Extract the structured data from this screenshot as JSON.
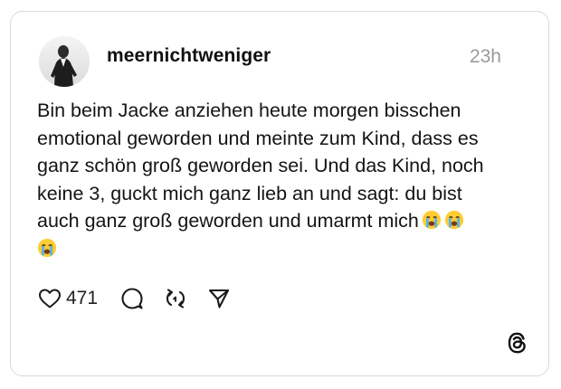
{
  "post": {
    "author": {
      "username": "meernichtweniger",
      "avatar_icon": "profile-photo"
    },
    "timestamp": "23h",
    "text_lines": [
      "Bin beim Jacke anziehen heute morgen bisschen",
      "emotional geworden und meinte zum Kind, dass es",
      "ganz schön groß geworden sei. Und das Kind, noch",
      "keine 3, guckt mich ganz lieb an und sagt: du bist",
      "auch ganz groß geworden und umarmt mich"
    ],
    "emojis": [
      "loudly-crying-face",
      "loudly-crying-face",
      "loudly-crying-face"
    ],
    "actions": {
      "like_icon": "heart-icon",
      "like_count": "471",
      "reply_icon": "comment-icon",
      "repost_icon": "repost-icon",
      "share_icon": "send-icon"
    },
    "brand_icon": "threads-logo"
  }
}
